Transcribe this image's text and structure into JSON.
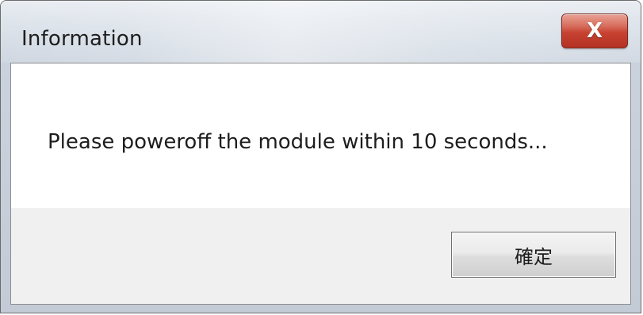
{
  "window": {
    "title": "Information"
  },
  "icons": {
    "close": "close-icon"
  },
  "close_glyph": "X",
  "dialog": {
    "message": "Please poweroff the module within 10 seconds...",
    "ok_label": "確定"
  },
  "colors": {
    "close_button": "#c74231",
    "content_background": "#ffffff",
    "footer_background": "#f0f0f0"
  }
}
